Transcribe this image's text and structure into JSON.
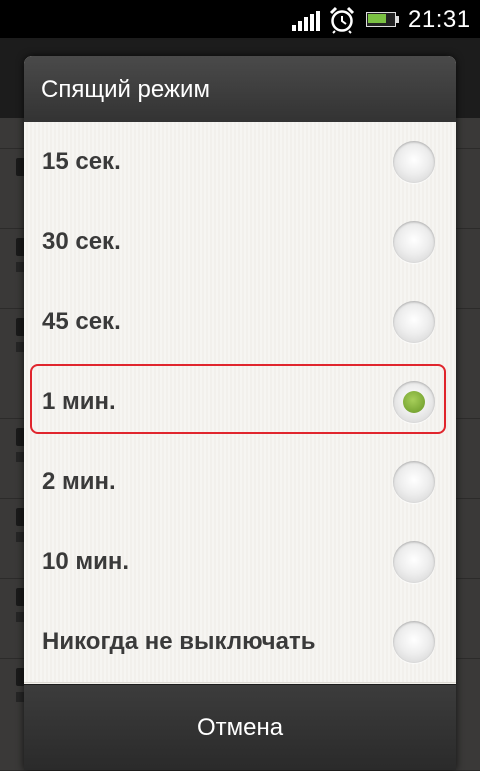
{
  "status_bar": {
    "time": "21:31",
    "icons": [
      "signal-icon",
      "alarm-clock-icon",
      "battery-icon"
    ],
    "battery_level": 0.75
  },
  "dialog": {
    "title": "Спящий режим",
    "options": [
      {
        "label": "15 сек.",
        "selected": false
      },
      {
        "label": "30 сек.",
        "selected": false
      },
      {
        "label": "45 сек.",
        "selected": false
      },
      {
        "label": "1 мин.",
        "selected": true
      },
      {
        "label": "2 мин.",
        "selected": false
      },
      {
        "label": "10 мин.",
        "selected": false
      },
      {
        "label": "Никогда не выключать",
        "selected": false
      }
    ],
    "cancel_label": "Отмена"
  },
  "colors": {
    "accent_green": "#7aa735",
    "highlight_red": "#e0252d"
  }
}
